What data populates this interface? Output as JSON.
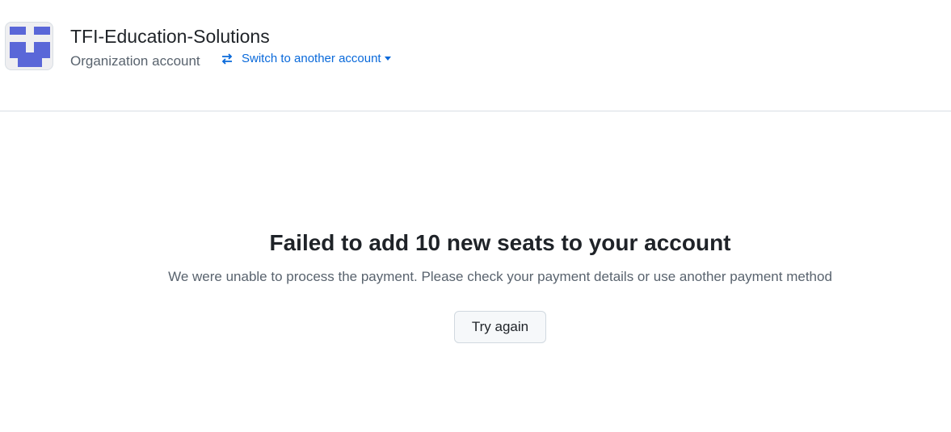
{
  "header": {
    "org_name": "TFI-Education-Solutions",
    "account_type": "Organization account",
    "switch_label": "Switch to another account",
    "logo_color": "#5a67d8"
  },
  "main": {
    "heading": "Failed to add 10 new seats to your account",
    "message": "We were unable to process the payment. Please check your payment details or use another payment method",
    "retry_label": "Try again"
  }
}
